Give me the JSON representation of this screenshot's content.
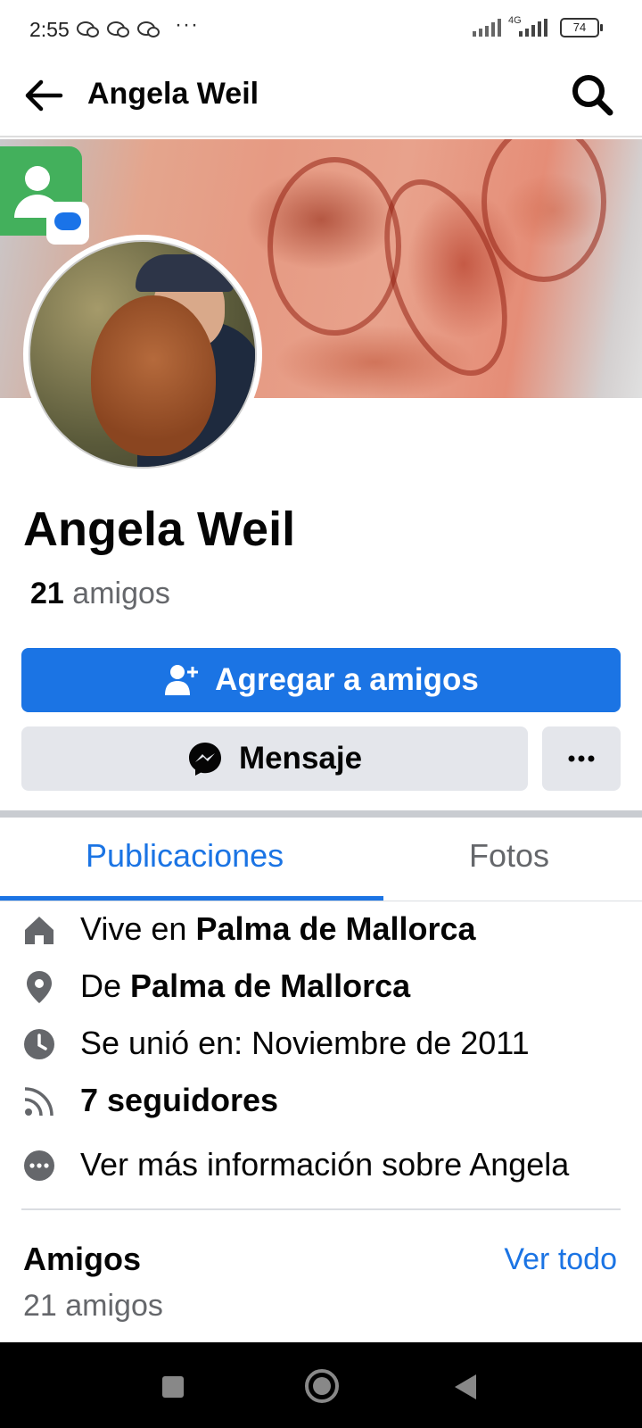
{
  "status_bar": {
    "time": "2:55",
    "more": "···",
    "network": "4G",
    "battery": "74"
  },
  "app_bar": {
    "title": "Angela Weil"
  },
  "profile": {
    "name": "Angela Weil",
    "friends_count": "21",
    "friends_label": "amigos"
  },
  "actions": {
    "add_friend": "Agregar a amigos",
    "message": "Mensaje",
    "more": "···"
  },
  "tabs": [
    {
      "label": "Publicaciones",
      "active": true
    },
    {
      "label": "Fotos",
      "active": false
    }
  ],
  "details": {
    "lives_prefix": "Vive en ",
    "lives_city": "Palma de Mallorca",
    "from_prefix": "De ",
    "from_city": "Palma de Mallorca",
    "joined": "Se unió en: Noviembre de 2011",
    "followers": "7 seguidores",
    "more_info": "Ver más información sobre Angela"
  },
  "friends_section": {
    "title": "Amigos",
    "see_all": "Ver todo",
    "count": "21 amigos"
  },
  "colors": {
    "accent": "#1b74e4",
    "secondary_button": "#e4e6eb",
    "muted_text": "#65676b"
  }
}
